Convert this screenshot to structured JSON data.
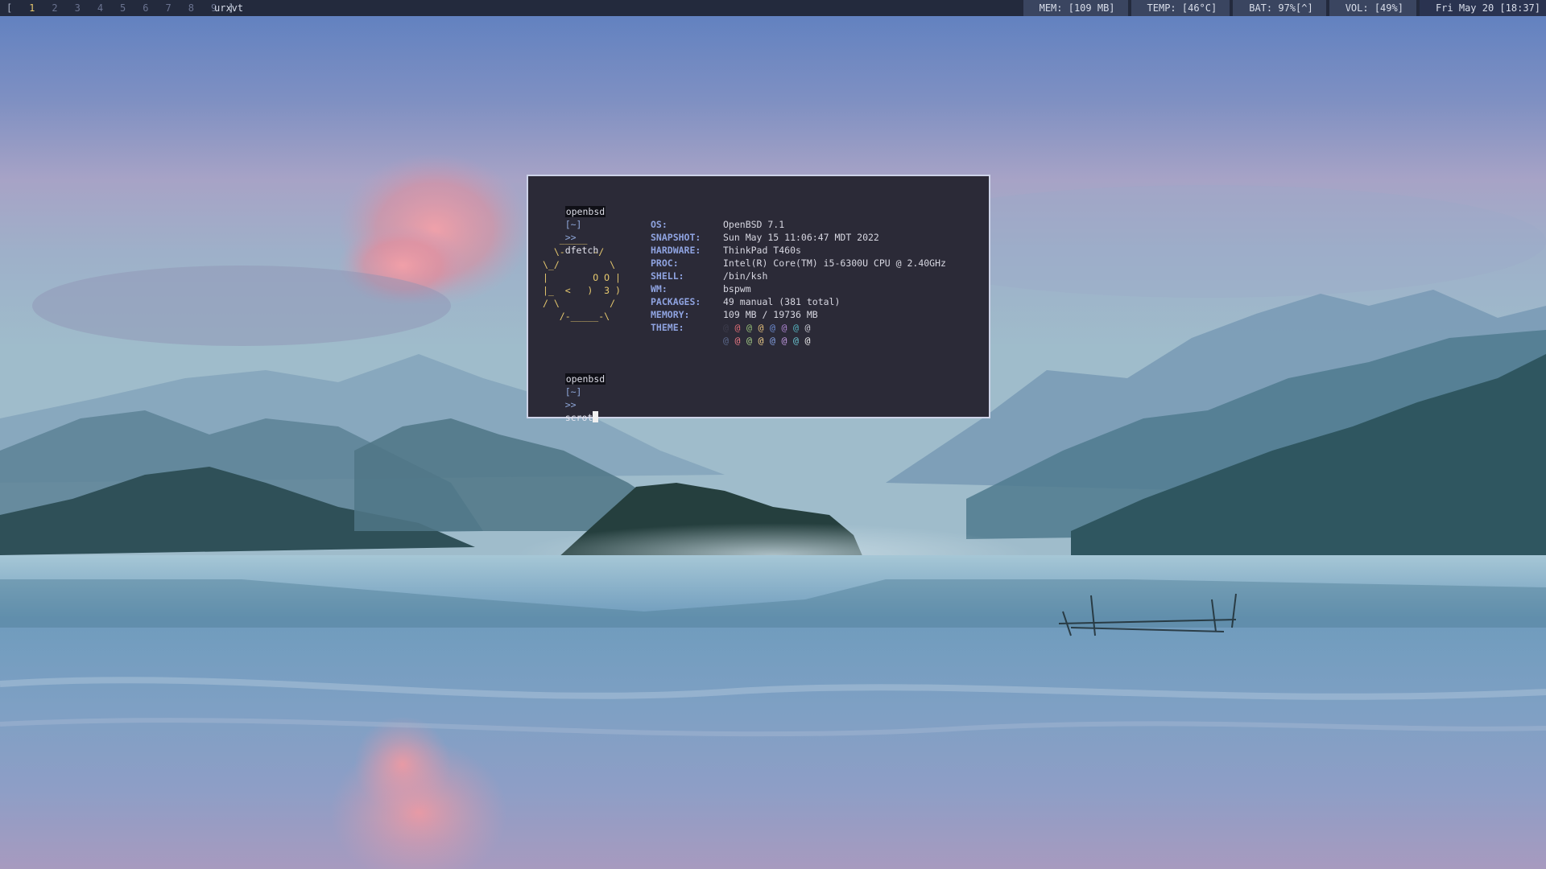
{
  "topbar": {
    "workspaces": {
      "open_bracket": "[",
      "close_bracket": "]",
      "items": [
        "1",
        "2",
        "3",
        "4",
        "5",
        "6",
        "7",
        "8",
        "9"
      ],
      "active": "1"
    },
    "window_title": "urxvt",
    "status": {
      "mem": "MEM: [109 MB]",
      "temp": "TEMP: [46°C]",
      "bat": "BAT: 97%[^]",
      "vol": "VOL: [49%]",
      "clock": "Fri May 20 [18:37]"
    }
  },
  "terminal": {
    "prompt": {
      "host": "openbsd",
      "dir": "[~]",
      "arrow": ">>"
    },
    "first_command": "dfetch",
    "second_command": "scrot",
    "logo_lines": [
      "   _____",
      "  \\-     -/",
      "\\_/         \\",
      "|        O O |",
      "|_  <   )  3 )",
      "/ \\         /",
      "   /-_____-\\"
    ],
    "info": [
      {
        "key": "OS:",
        "value": "OpenBSD 7.1"
      },
      {
        "key": "SNAPSHOT:",
        "value": "Sun May 15 11:06:47 MDT 2022"
      },
      {
        "key": "HARDWARE:",
        "value": "ThinkPad T460s"
      },
      {
        "key": "PROC:",
        "value": "Intel(R) Core(TM) i5-6300U CPU @ 2.40GHz"
      },
      {
        "key": "SHELL:",
        "value": "/bin/ksh"
      },
      {
        "key": "WM:",
        "value": "bspwm"
      },
      {
        "key": "PACKAGES:",
        "value": "49 manual (381 total)"
      },
      {
        "key": "MEMORY:",
        "value": "109 MB / 19736 MB"
      },
      {
        "key": "THEME:",
        "value": ""
      }
    ],
    "theme_glyph": "@",
    "theme_row1_colors": [
      "#3d3d4c",
      "#e06c75",
      "#98c379",
      "#e5c07b",
      "#6e8fd6",
      "#b087d4",
      "#56b6c2",
      "#c8c8d2"
    ],
    "theme_row2_colors": [
      "#5d6b8e",
      "#ef7a86",
      "#a9d38a",
      "#f0d08c",
      "#86a3e6",
      "#c39be2",
      "#6dc8d4",
      "#eeeeee"
    ]
  },
  "colors": {
    "bar_bg": "#232a3d",
    "bar_segment": "#3a4560",
    "active_workspace": "#e6c86e",
    "terminal_bg": "#2b2a37",
    "terminal_border": "#cdd3e8",
    "info_key": "#8fa3e0",
    "logo": "#e6c86e"
  }
}
